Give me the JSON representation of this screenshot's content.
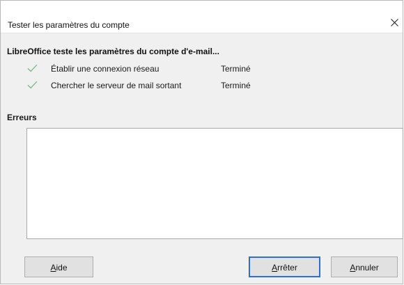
{
  "window": {
    "title": "Tester les paramètres du compte",
    "close_icon": "close-icon"
  },
  "progress": {
    "heading": "LibreOffice teste les paramètres du compte d'e-mail...",
    "tasks": [
      {
        "label": "Établir une connexion réseau",
        "status": "Terminé",
        "icon": "checkmark-icon"
      },
      {
        "label": "Chercher le serveur de mail sortant",
        "status": "Terminé",
        "icon": "checkmark-icon"
      }
    ]
  },
  "errors": {
    "label": "Erreurs",
    "content": ""
  },
  "buttons": {
    "help": {
      "mnemonic": "A",
      "rest": "ide"
    },
    "stop": {
      "mnemonic": "A",
      "rest": "rrêter"
    },
    "cancel": {
      "mnemonic": "A",
      "rest": "nnuler"
    }
  },
  "colors": {
    "check": "#7fba8a",
    "default_button_border": "#2b6fd6"
  }
}
